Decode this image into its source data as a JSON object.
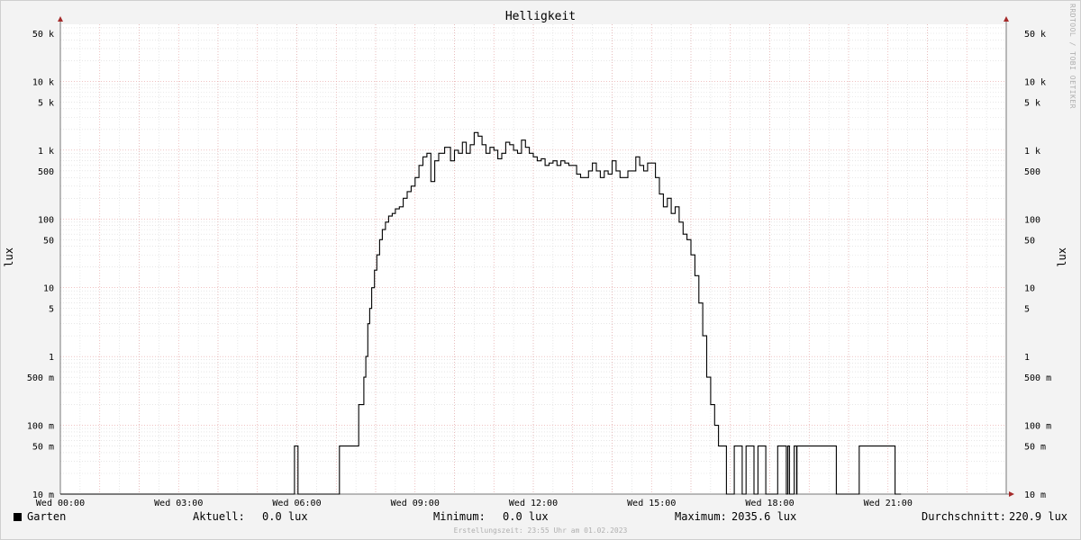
{
  "chart_data": {
    "type": "line",
    "title": "Helligkeit",
    "ylabel": "lux",
    "yscale": "log",
    "ylim": [
      0.01,
      80000
    ],
    "xlim": [
      "Wed 00:00",
      "Wed 23:55"
    ],
    "y_ticks": [
      {
        "value": 50000,
        "label": "50 k"
      },
      {
        "value": 10000,
        "label": "10 k"
      },
      {
        "value": 5000,
        "label": "5 k"
      },
      {
        "value": 1000,
        "label": "1 k"
      },
      {
        "value": 500,
        "label": "500"
      },
      {
        "value": 100,
        "label": "100"
      },
      {
        "value": 50,
        "label": "50"
      },
      {
        "value": 10,
        "label": "10"
      },
      {
        "value": 5,
        "label": "5"
      },
      {
        "value": 1,
        "label": "1"
      },
      {
        "value": 0.5,
        "label": "500 m"
      },
      {
        "value": 0.1,
        "label": "100 m"
      },
      {
        "value": 0.05,
        "label": "50 m"
      },
      {
        "value": 0.01,
        "label": "10 m"
      }
    ],
    "x_ticks": [
      {
        "hour": 0,
        "label": "Wed 00:00"
      },
      {
        "hour": 3,
        "label": "Wed 03:00"
      },
      {
        "hour": 6,
        "label": "Wed 06:00"
      },
      {
        "hour": 9,
        "label": "Wed 09:00"
      },
      {
        "hour": 12,
        "label": "Wed 12:00"
      },
      {
        "hour": 15,
        "label": "Wed 15:00"
      },
      {
        "hour": 18,
        "label": "Wed 18:00"
      },
      {
        "hour": 21,
        "label": "Wed 21:00"
      }
    ],
    "series": [
      {
        "name": "Garten",
        "color": "#000000",
        "x_hours": [
          0,
          5.93,
          5.94,
          6.02,
          6.03,
          7.07,
          7.08,
          7.54,
          7.57,
          7.65,
          7.7,
          7.75,
          7.8,
          7.85,
          7.9,
          7.97,
          8.03,
          8.1,
          8.17,
          8.25,
          8.33,
          8.42,
          8.5,
          8.6,
          8.7,
          8.8,
          8.9,
          9.0,
          9.1,
          9.2,
          9.3,
          9.4,
          9.5,
          9.6,
          9.75,
          9.9,
          10.0,
          10.1,
          10.2,
          10.3,
          10.4,
          10.5,
          10.6,
          10.7,
          10.8,
          10.9,
          11.0,
          11.1,
          11.2,
          11.3,
          11.4,
          11.5,
          11.6,
          11.7,
          11.8,
          11.9,
          12.0,
          12.1,
          12.2,
          12.3,
          12.4,
          12.5,
          12.6,
          12.7,
          12.8,
          12.9,
          13.0,
          13.1,
          13.2,
          13.3,
          13.4,
          13.5,
          13.6,
          13.7,
          13.8,
          13.9,
          14.0,
          14.1,
          14.2,
          14.3,
          14.4,
          14.5,
          14.6,
          14.7,
          14.8,
          14.9,
          15.0,
          15.1,
          15.2,
          15.3,
          15.4,
          15.5,
          15.6,
          15.7,
          15.8,
          15.9,
          16.0,
          16.1,
          16.2,
          16.3,
          16.4,
          16.5,
          16.6,
          16.7,
          16.8,
          16.9,
          17.0,
          17.1,
          17.2,
          17.3,
          17.4,
          17.5,
          17.6,
          17.7,
          17.8,
          17.9,
          18.0,
          18.2,
          18.21,
          18.42,
          18.43,
          18.46,
          18.47,
          18.5,
          18.51,
          18.62,
          18.63,
          18.68,
          18.69,
          19.68,
          19.69,
          20.27,
          20.28,
          21.18,
          21.19,
          21.33,
          21.34,
          23.33,
          23.34,
          23.5,
          23.51,
          23.56,
          23.57,
          23.71,
          23.72,
          23.8,
          23.81,
          23.92
        ],
        "values": [
          0.01,
          0.01,
          0.05,
          0.05,
          0.01,
          0.01,
          0.05,
          0.05,
          0.2,
          0.2,
          0.5,
          1,
          3,
          5,
          10,
          18,
          30,
          50,
          70,
          90,
          110,
          120,
          140,
          150,
          200,
          250,
          300,
          400,
          600,
          800,
          900,
          350,
          700,
          900,
          1100,
          700,
          1000,
          900,
          1300,
          900,
          1200,
          1800,
          1600,
          1200,
          900,
          1100,
          1000,
          750,
          900,
          1300,
          1200,
          1000,
          900,
          1400,
          1100,
          900,
          800,
          700,
          750,
          600,
          650,
          700,
          600,
          700,
          650,
          600,
          600,
          450,
          400,
          400,
          500,
          650,
          500,
          400,
          500,
          450,
          700,
          500,
          400,
          400,
          500,
          500,
          800,
          600,
          500,
          650,
          650,
          400,
          230,
          150,
          200,
          120,
          150,
          90,
          60,
          50,
          30,
          15,
          6,
          2,
          0.5,
          0.2,
          0.1,
          0.05,
          0.05,
          0.01,
          0.01,
          0.05,
          0.05,
          0.01,
          0.05,
          0.05,
          0.01,
          0.05,
          0.05,
          0.01,
          0.01,
          0.05,
          0.05,
          0.01,
          0.01,
          0.05,
          0.05,
          0.01,
          0.01,
          0.05,
          0.05,
          0.01,
          0.05,
          0.05,
          0.01,
          0.05,
          0.05,
          0.01,
          0.01
        ]
      }
    ],
    "grid": true,
    "legend": "bottom-left"
  },
  "legend": {
    "series_label": "Garten",
    "current_label": "Aktuell:",
    "current_value": "0.0 lux",
    "min_label": "Minimum:",
    "min_value": "0.0 lux",
    "max_label": "Maximum:",
    "max_value": "2035.6 lux",
    "avg_label": "Durchschnitt:",
    "avg_value": "220.9 lux"
  },
  "watermark": "RRDTOOL / TOBI OETIKER",
  "credit": "Erstellungszeit: 23:55 Uhr am 01.02.2023"
}
